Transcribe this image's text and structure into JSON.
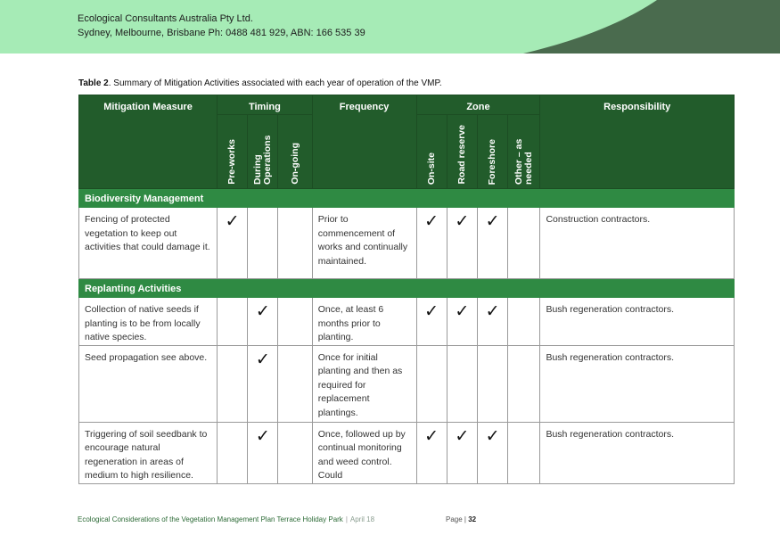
{
  "header": {
    "company_line1": "Ecological Consultants Australia Pty Ltd.",
    "company_line2": "Sydney, Melbourne, Brisbane Ph: 0488 481 929, ABN: 166 535 39",
    "colors": {
      "band": "#a6ebb6",
      "swoosh": "#4a6b4e"
    }
  },
  "caption": {
    "label": "Table 2",
    "text": ". Summary of Mitigation Activities associated with each year of operation of the VMP."
  },
  "table": {
    "headers": {
      "measure": "Mitigation Measure",
      "timing": "Timing",
      "frequency": "Frequency",
      "zone": "Zone",
      "responsibility": "Responsibility",
      "timing_sub": [
        "Pre-works",
        "During Operations",
        "On-going"
      ],
      "zone_sub": [
        "On-site",
        "Road reserve",
        "Foreshore",
        "Other – as needed"
      ]
    },
    "check_glyph": "✓",
    "sections": [
      {
        "title": "Biodiversity Management",
        "rows": [
          {
            "measure": "Fencing of protected vegetation to keep out activities that could damage it.",
            "timing": [
              true,
              false,
              false
            ],
            "frequency": "Prior to commencement of works and continually maintained.",
            "zone": [
              true,
              true,
              true,
              false
            ],
            "responsibility": "Construction contractors."
          }
        ]
      },
      {
        "title": "Replanting Activities",
        "rows": [
          {
            "measure": "Collection of native seeds if planting is to be from locally native species.",
            "timing": [
              false,
              true,
              false
            ],
            "frequency": "Once, at least 6 months prior to planting.",
            "zone": [
              true,
              true,
              true,
              false
            ],
            "responsibility": "Bush regeneration contractors."
          },
          {
            "measure": "Seed propagation see above.",
            "timing": [
              false,
              true,
              false
            ],
            "frequency": "Once for initial planting and then as required for replacement plantings.",
            "zone": [
              false,
              false,
              false,
              false
            ],
            "responsibility": "Bush regeneration contractors."
          },
          {
            "measure": "Triggering of soil seedbank to encourage natural regeneration in areas of medium to high resilience.",
            "timing": [
              false,
              true,
              false
            ],
            "frequency": "Once, followed up by continual monitoring and weed control.  Could",
            "zone": [
              true,
              true,
              true,
              false
            ],
            "responsibility": "Bush regeneration contractors."
          }
        ]
      }
    ]
  },
  "footer": {
    "title": "Ecological Considerations of the Vegetation Management Plan Terrace Holiday Park",
    "separator": "|",
    "date": "April 18",
    "page_label": "Page |",
    "page_number": "32"
  }
}
